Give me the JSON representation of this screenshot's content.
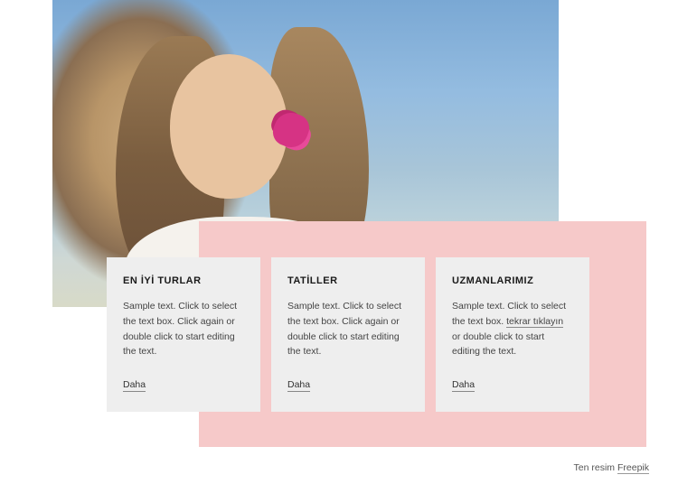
{
  "cards": [
    {
      "title": "EN İYİ TURLAR",
      "text": "Sample text. Click to select the text box. Click again or double click to start editing the text.",
      "link": "Daha"
    },
    {
      "title": "TATİLLER",
      "text": "Sample text. Click to select the text box. Click again or double click to start editing the text.",
      "link": "Daha"
    },
    {
      "title": "UZMANLARIMIZ",
      "text_before": "Sample text. Click to select the text box. ",
      "inline_link": "tekrar tıklayın",
      "text_after": " or double click to start editing the text.",
      "link": "Daha"
    }
  ],
  "attribution": {
    "prefix": "Ten resim ",
    "link_text": "Freepik"
  }
}
